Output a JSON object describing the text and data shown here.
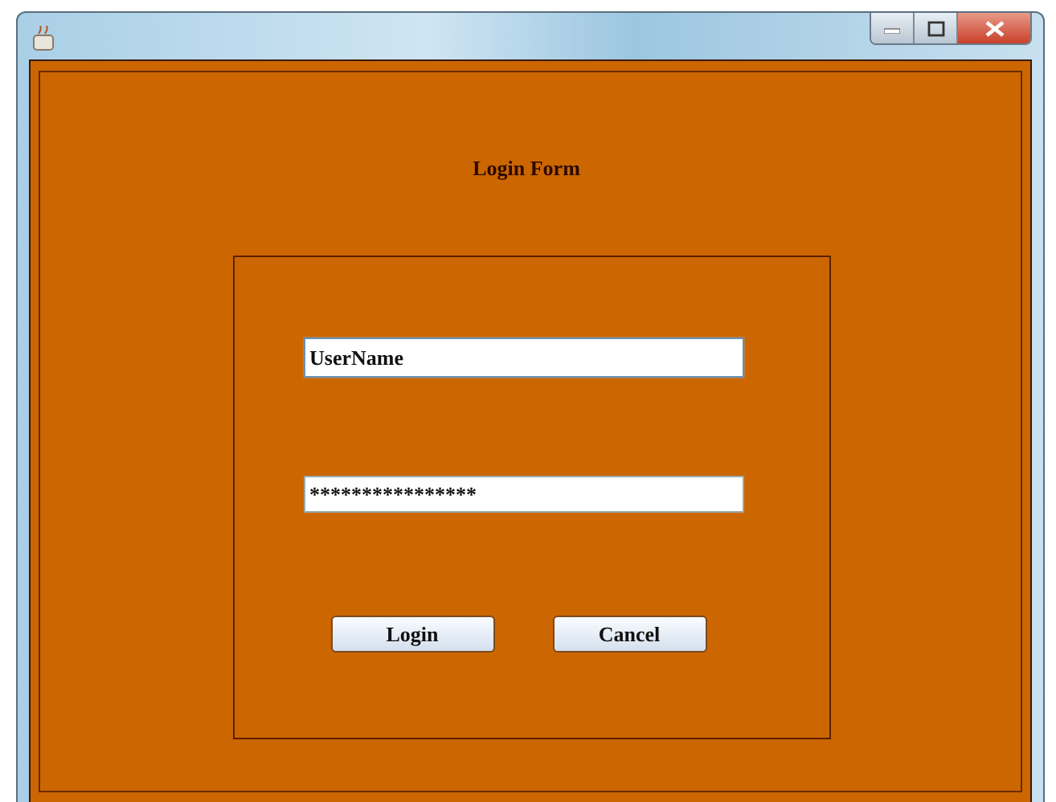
{
  "form": {
    "title": "Login Form",
    "fields": [
      {
        "kind": "text",
        "value": "UserName",
        "focused": true
      },
      {
        "kind": "password",
        "value": "****************",
        "focused": false
      }
    ],
    "buttons": [
      "Login",
      "Cancel"
    ]
  }
}
